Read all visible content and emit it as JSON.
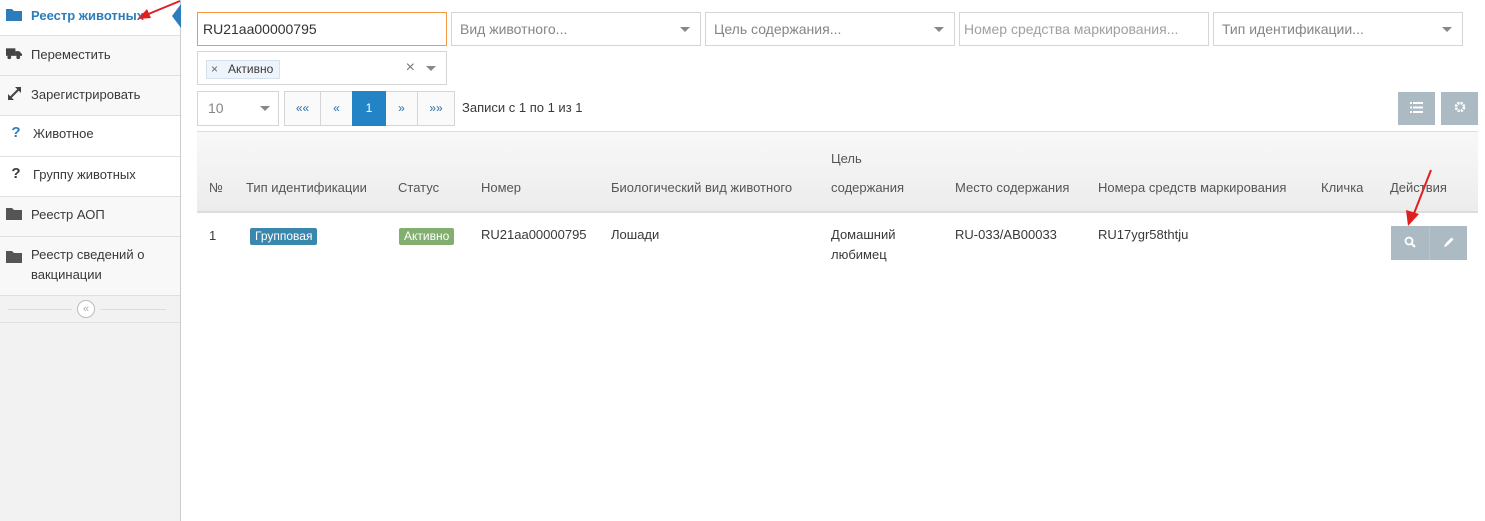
{
  "sidebar": {
    "items": [
      {
        "label": "Реестр животных",
        "icon": "folder-icon"
      },
      {
        "label": "Переместить",
        "icon": "truck-icon"
      },
      {
        "label": "Зарегистрировать",
        "icon": "expand-arrows-icon"
      },
      {
        "label": "Животное",
        "icon": "question-icon"
      },
      {
        "label": "Группу животных",
        "icon": "question-icon"
      },
      {
        "label": "Реестр АОП",
        "icon": "folder-icon"
      },
      {
        "label": "Реестр сведений о вакцинации",
        "icon": "folder-icon"
      }
    ],
    "collapse_glyph": "«"
  },
  "filters": {
    "search_value": "RU21aa00000795",
    "species_placeholder": "Вид животного...",
    "purpose_placeholder": "Цель содержания...",
    "marking_placeholder": "Номер средства маркирования...",
    "id_type_placeholder": "Тип идентификации...",
    "status_chip": "Активно",
    "chip_remove": "×",
    "clear": "×"
  },
  "pagination": {
    "page_size": "10",
    "first": "««",
    "prev": "«",
    "current": "1",
    "next": "»",
    "last": "»»",
    "records_info": "Записи с 1 по 1 из 1"
  },
  "table": {
    "headers": {
      "num": "№",
      "id_type": "Тип идентификации",
      "status": "Статус",
      "number": "Номер",
      "species": "Биологический вид животного",
      "purpose_line1": "Цель",
      "purpose_line2": "содержания",
      "place": "Место содержания",
      "marking": "Номера средств маркирования",
      "nickname": "Кличка",
      "actions": "Действия"
    },
    "rows": [
      {
        "num": "1",
        "id_type": "Групповая",
        "status": "Активно",
        "number": "RU21aa00000795",
        "species": "Лошади",
        "purpose_line1": "Домашний",
        "purpose_line2": "любимец",
        "place": "RU-033/AB00033",
        "marking": "RU17ygr58thtju",
        "nickname": ""
      }
    ]
  },
  "colors": {
    "accent": "#2b7dbc",
    "badge_group": "#3a87ad",
    "badge_active": "#82af6f",
    "annotation_arrow": "#e02020",
    "button_gray": "#abbac3"
  }
}
